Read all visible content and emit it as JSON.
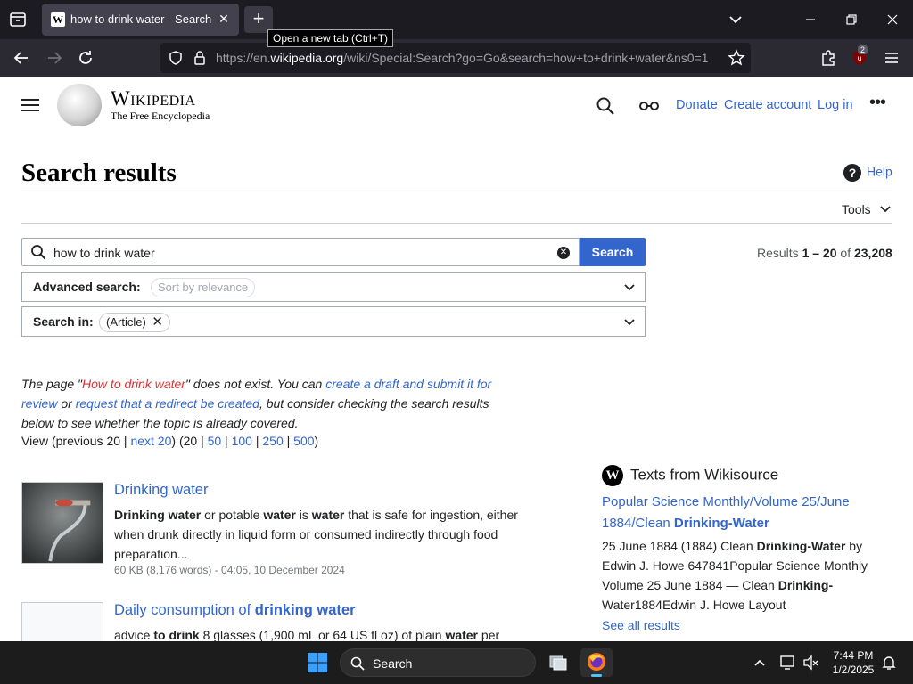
{
  "browser": {
    "tab_title": "how to drink water - Search results - Wikipedia",
    "new_tab_tooltip": "Open a new tab (Ctrl+T)",
    "url_prefix": "https://en.",
    "url_domain": "wikipedia.org",
    "url_rest": "/wiki/Special:Search?go=Go&search=how+to+drink+water&ns0=1",
    "extensions_badge": "2"
  },
  "header": {
    "wordmark": "Wikipedia",
    "tagline": "The Free Encyclopedia",
    "links": {
      "donate": "Donate",
      "create_account": "Create account",
      "login": "Log in"
    }
  },
  "page": {
    "title": "Search results",
    "help": "Help",
    "tools": "Tools"
  },
  "search": {
    "value": "how to drink water",
    "button": "Search",
    "results_prefix": "Results ",
    "results_range": "1 – 20",
    "results_of": " of ",
    "results_total": "23,208",
    "advanced_label": "Advanced search:",
    "advanced_chip": "Sort by relevance",
    "search_in_label": "Search in:",
    "search_in_chip": "(Article)"
  },
  "notice": {
    "t1": "The page \"",
    "page_link": "How to drink water",
    "t2": "\" does not exist. You can ",
    "draft_link": "create a draft and submit it for review",
    "t3": " or ",
    "redirect_link": "request that a redirect be created",
    "t4": ", but consider checking the search results below to see whether the topic is already covered."
  },
  "view": {
    "prefix": "View (previous 20 | ",
    "next": "next 20",
    "mid": ") (20 | ",
    "n50": "50",
    "n100": "100",
    "n250": "250",
    "n500": "500",
    "sep": " | ",
    "end": ")"
  },
  "results": [
    {
      "title": "Drinking water",
      "snippet_html": "<b>Drinking water</b> or potable <b>water</b> is <b>water</b> that is safe for ingestion, either when drunk directly in liquid form or consumed indirectly through food preparation...",
      "meta": "60 KB (8,176 words) - 04:05, 10 December 2024"
    },
    {
      "title_pre": "Daily consumption of ",
      "title_bold": "drinking water",
      "snippet_html": "advice <b>to drink</b> 8 glasses (1,900 mL or 64 US fl oz) of plain <b>water</b> per"
    }
  ],
  "sidebar": {
    "heading": "Texts from Wikisource",
    "link_html": "Popular Science Monthly/Volume 25/June 1884/Clean <b>Drinking-Water</b>",
    "snippet_html": "25 June 1884 (1884) Clean <b>Drinking-Water</b> by Edwin J. Howe 647841Popular Science Monthly Volume 25 June 1884 — Clean <b>Drinking-</b>Water1884Edwin J. Howe Layout",
    "see_all": "See all results"
  },
  "taskbar": {
    "search_label": "Search",
    "time": "7:44 PM",
    "date": "1/2/2025"
  },
  "colors": {
    "link": "#3366cc",
    "redlink": "#dd3333",
    "accent_button": "#3366cc",
    "taskbar": "#1c1c1c",
    "browser_chrome": "#1c1b22"
  }
}
